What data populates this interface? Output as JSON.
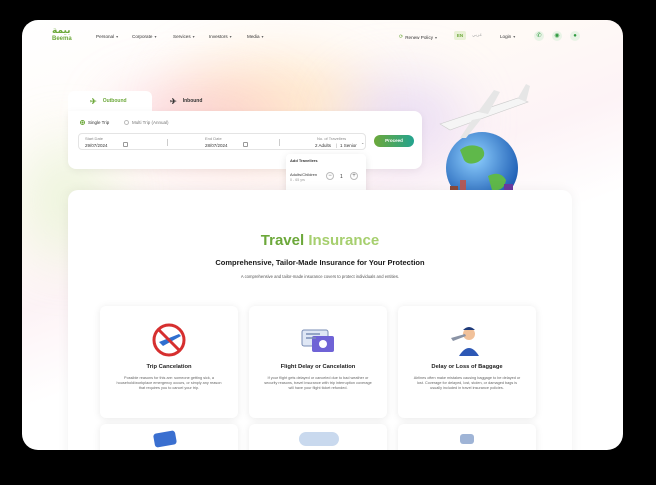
{
  "brand": {
    "name": "Beema",
    "arabic": "بيمة",
    "accent": "#6ca83a",
    "accent2": "#24a38f"
  },
  "nav": {
    "items": [
      {
        "label": "Personal"
      },
      {
        "label": "Corporate"
      },
      {
        "label": "Services"
      },
      {
        "label": "Investors"
      },
      {
        "label": "Media"
      }
    ],
    "renew_policy": "Renew Policy",
    "lang_en": "EN",
    "lang_ar": "عربي",
    "login": "Login",
    "icons": [
      "phone-icon",
      "whatsapp-icon",
      "chat-icon"
    ]
  },
  "booking": {
    "tabs": [
      {
        "label": "Outbound"
      },
      {
        "label": "Inbound"
      }
    ],
    "trip_types": [
      {
        "label": "Single Trip",
        "selected": true
      },
      {
        "label": "Multi Trip (Annual)",
        "selected": false
      }
    ],
    "start_date": {
      "label": "Start Date",
      "value": "29/07/2024"
    },
    "end_date": {
      "label": "End Date",
      "value": "28/07/2024"
    },
    "travellers": {
      "label": "No. of Travellers",
      "adults_text": "2 Adults",
      "senior_text": "1 Senior"
    },
    "proceed": "Proceed",
    "dropdown": {
      "title": "Add Travellers",
      "adults": {
        "label": "Adults/Children",
        "range": "0 - 65 yrs",
        "count": "1"
      },
      "seniors": {
        "label": "Seniors",
        "range": "66 - 80 yrs",
        "count": "0"
      }
    }
  },
  "main": {
    "title_a": "Travel",
    "title_b": "Insurance",
    "heading": "Comprehensive, Tailor-Made Insurance for Your Protection",
    "subheading": "A comprehensive and tailor-made insurance covers to protect individuals and entities.",
    "features": [
      {
        "title": "Trip Cancelation",
        "desc": "Possible reasons for this are: someone getting sick, a household/workplace emergency occurs, or simply any reason that requires you to cancel your trip.",
        "icon": "no-plane-icon"
      },
      {
        "title": "Flight Delay or Cancelation",
        "desc": "If your flight gets delayed or canceled due to bad weather or security reasons, travel insurance with trip interruption coverage will have your flight ticket refunded.",
        "icon": "ticket-icon"
      },
      {
        "title": "Delay or Loss of Baggage",
        "desc": "Airlines often make mistakes causing baggage to be delayed or lost. Coverage for delayed, lost, stolen, or damaged bags is usually included in travel insurance policies.",
        "icon": "pilot-icon"
      }
    ]
  }
}
